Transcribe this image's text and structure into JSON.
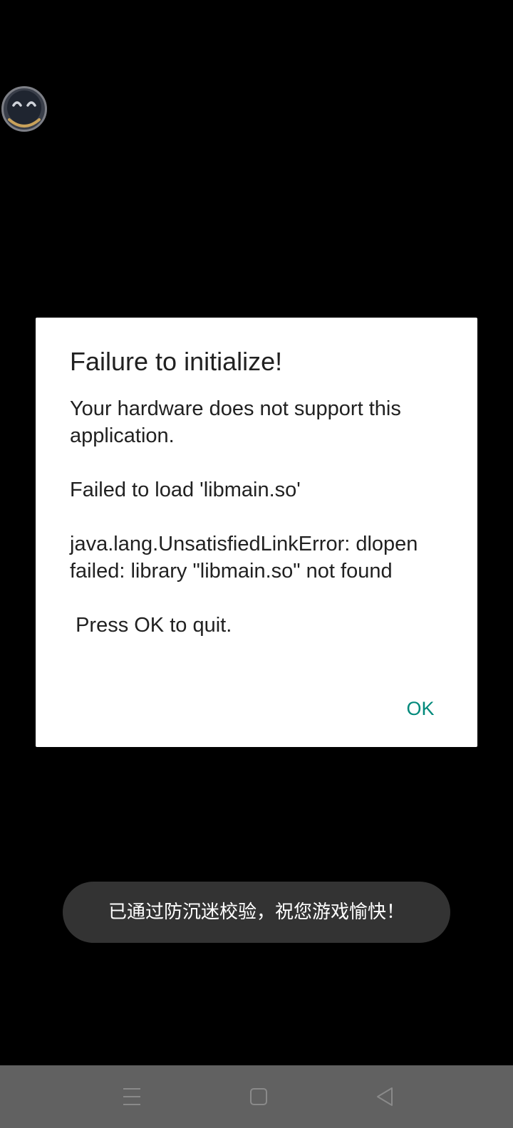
{
  "dialog": {
    "title": "Failure to initialize!",
    "message": "Your hardware does not support this application.\n\nFailed to load 'libmain.so'\n\njava.lang.UnsatisfiedLinkError: dlopen failed: library \"libmain.so\" not found\n\n Press OK to quit.",
    "ok_label": "OK"
  },
  "toast": {
    "text": "已通过防沉迷校验，祝您游戏愉快！"
  },
  "floating_bubble": {
    "icon": "smiling-face-icon"
  },
  "nav_bar": {
    "menu_icon": "menu-icon",
    "home_icon": "home-square-icon",
    "back_icon": "back-triangle-icon"
  },
  "colors": {
    "background": "#000000",
    "dialog_background": "#ffffff",
    "text_primary": "#212121",
    "accent": "#00897b",
    "toast_background": "#333333",
    "nav_bar_background": "#616161"
  }
}
